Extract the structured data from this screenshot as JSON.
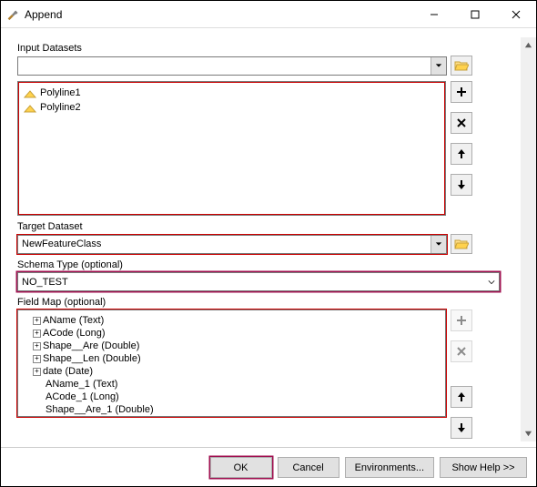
{
  "window": {
    "title": "Append"
  },
  "labels": {
    "input_datasets": "Input Datasets",
    "target_dataset": "Target Dataset",
    "schema_type": "Schema Type (optional)",
    "field_map": "Field Map (optional)"
  },
  "input_datasets": {
    "combo_value": "",
    "items": [
      "Polyline1",
      "Polyline2"
    ]
  },
  "target_dataset": {
    "value": "NewFeatureClass"
  },
  "schema_type": {
    "value": "NO_TEST"
  },
  "field_map": {
    "nodes": [
      {
        "label": "AName (Text)",
        "expandable": true,
        "indent": 0
      },
      {
        "label": "ACode (Long)",
        "expandable": true,
        "indent": 0
      },
      {
        "label": "Shape__Are (Double)",
        "expandable": true,
        "indent": 0
      },
      {
        "label": "Shape__Len (Double)",
        "expandable": true,
        "indent": 0
      },
      {
        "label": "date (Date)",
        "expandable": true,
        "indent": 0
      },
      {
        "label": "AName_1 (Text)",
        "expandable": false,
        "indent": 1
      },
      {
        "label": "ACode_1 (Long)",
        "expandable": false,
        "indent": 1
      },
      {
        "label": "Shape__Are_1 (Double)",
        "expandable": false,
        "indent": 1
      }
    ]
  },
  "buttons": {
    "ok": "OK",
    "cancel": "Cancel",
    "environments": "Environments...",
    "show_help": "Show Help >>"
  }
}
